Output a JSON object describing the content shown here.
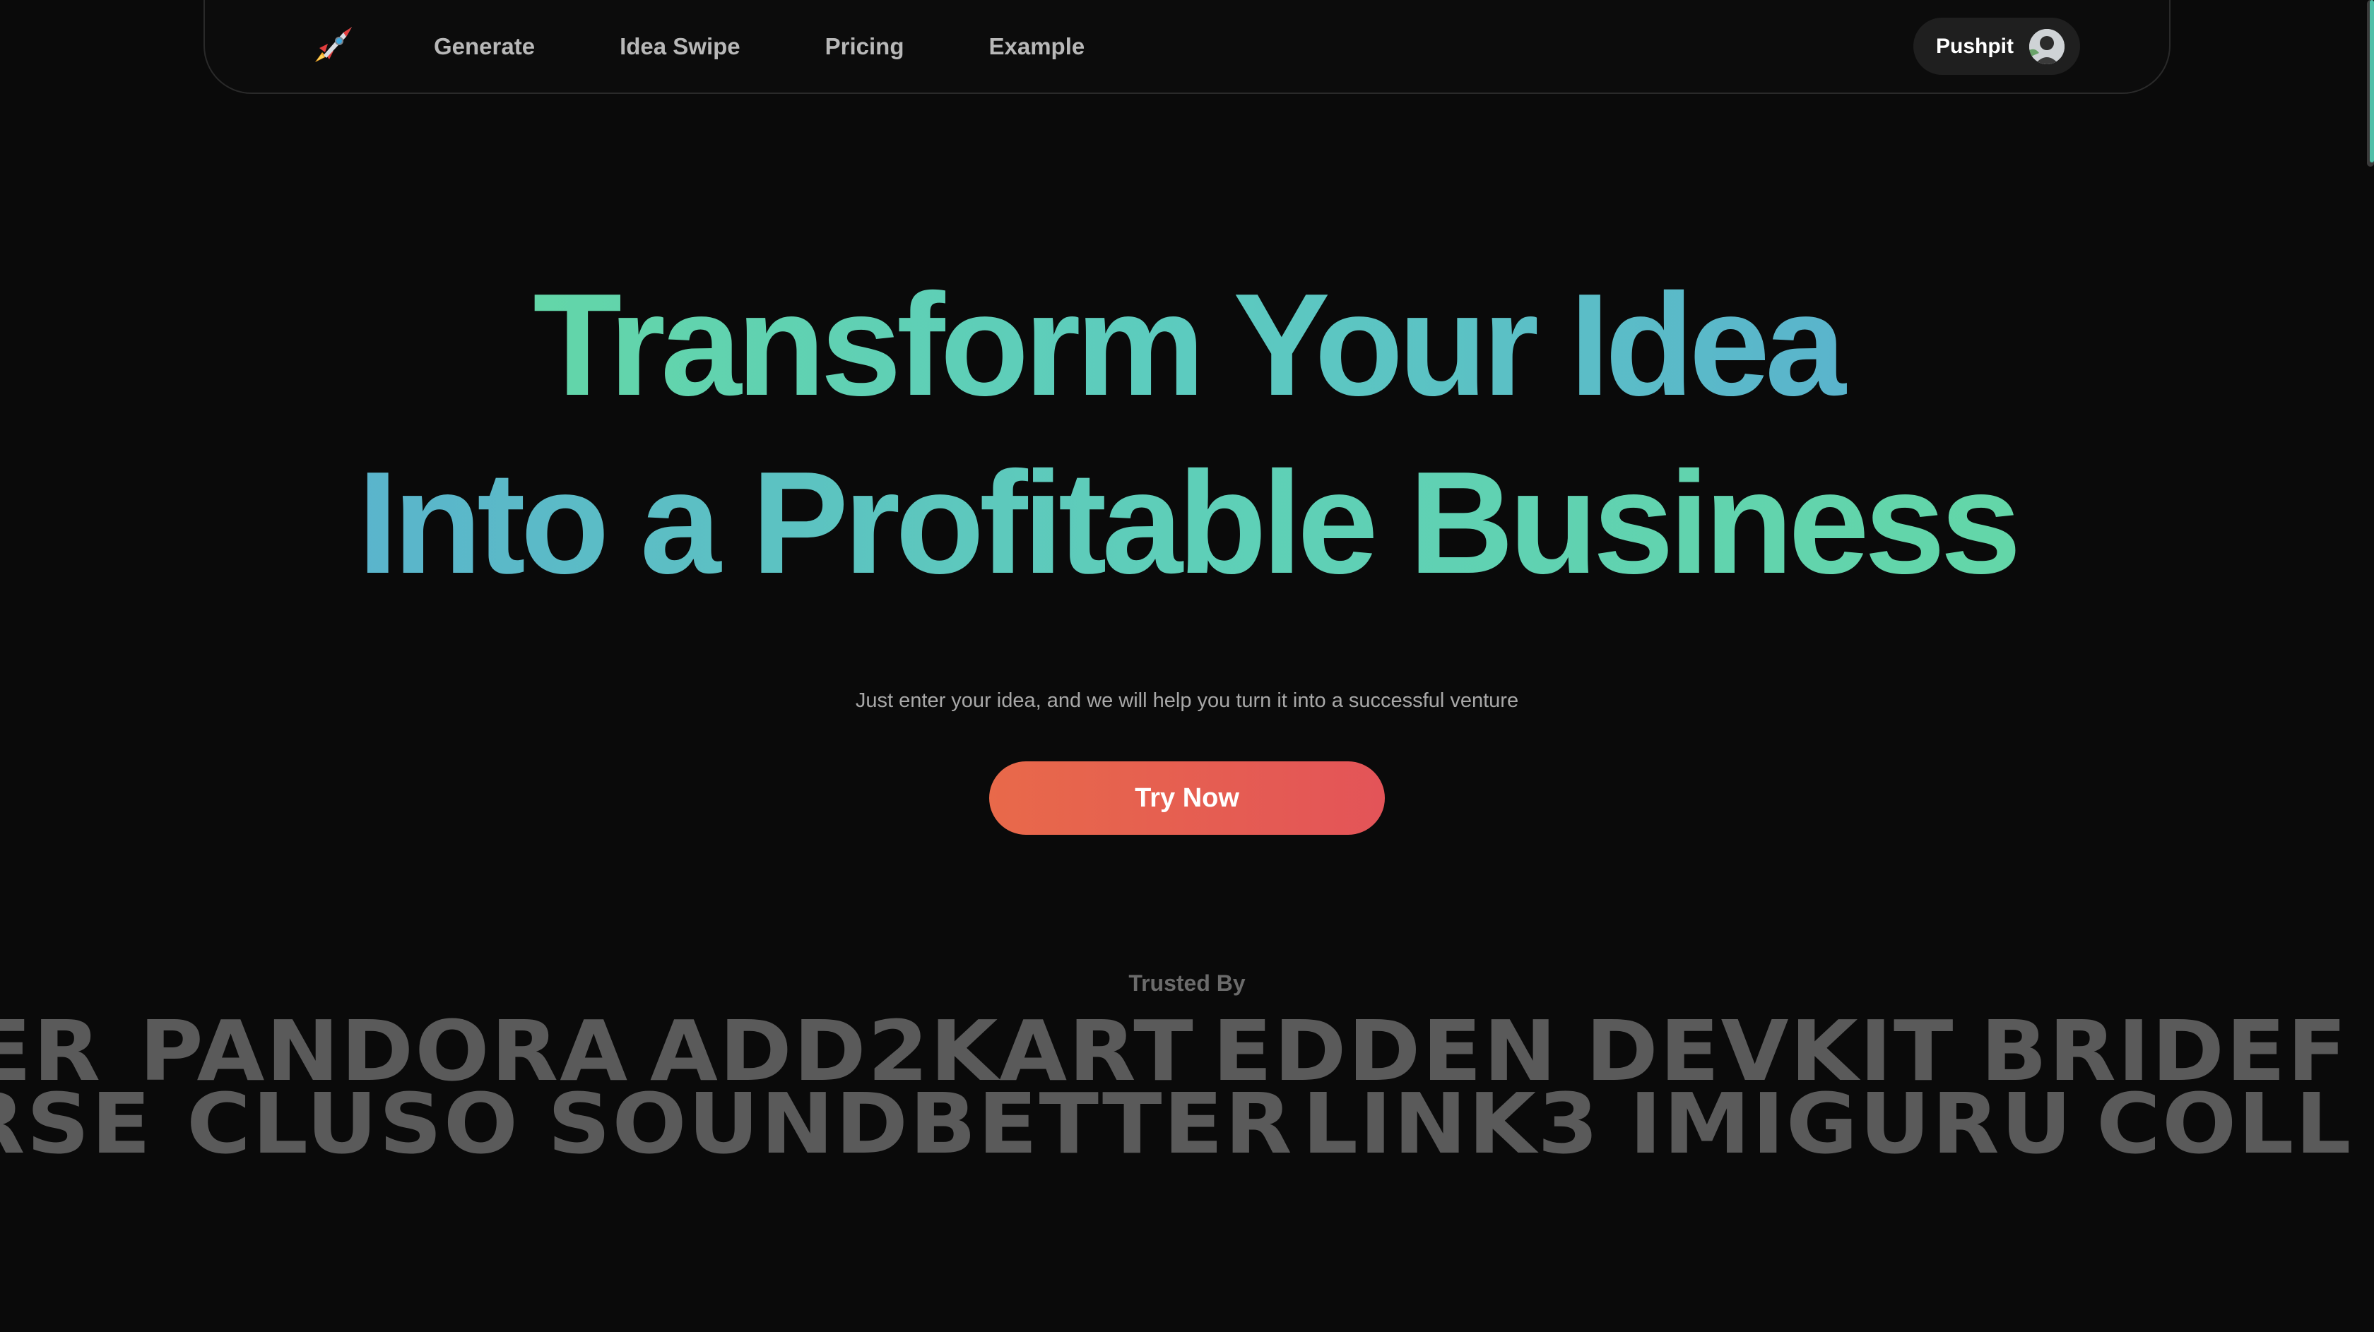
{
  "nav": {
    "logo_icon": "rocket-icon",
    "links": [
      {
        "label": "Generate"
      },
      {
        "label": "Idea Swipe"
      },
      {
        "label": "Pricing"
      },
      {
        "label": "Example"
      }
    ],
    "user": {
      "name": "Pushpit",
      "avatar_icon": "avatar-icon"
    }
  },
  "hero": {
    "title_line1": "Transform Your Idea",
    "title_line2": "Into a Profitable Business",
    "subtitle": "Just enter your idea, and we will help you turn it into a successful venture",
    "cta_label": "Try Now"
  },
  "trusted": {
    "label": "Trusted By",
    "row1": [
      "ER",
      "PANDORA",
      "ADD2KART",
      "EDDEN",
      "DEVKIT",
      "BRIDEF"
    ],
    "row2": [
      "RSE",
      "CLUSO",
      "SOUNDBETTER",
      "LINK3",
      "IMIGURU",
      "COLL"
    ]
  },
  "colors": {
    "background": "#0a0a0a",
    "accent_gradient_start": "#63d6a8",
    "accent_gradient_end": "#5ab4cc",
    "cta_gradient_start": "#e8694a",
    "cta_gradient_end": "#e35458",
    "brand_gray": "#5a5a5a"
  }
}
